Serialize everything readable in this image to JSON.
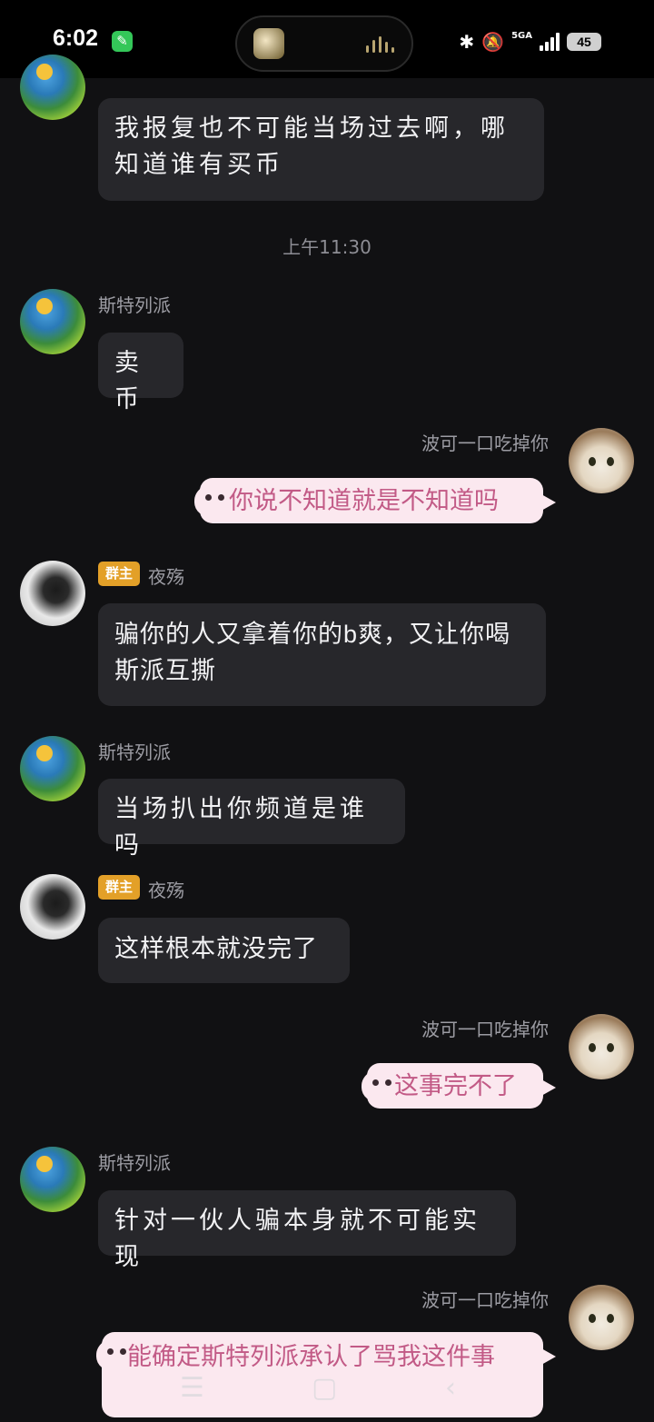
{
  "status_bar": {
    "time": "6:02",
    "network": "5GA",
    "battery": "45",
    "icons": [
      "wrench-app-icon",
      "bluetooth-icon",
      "mute-icon",
      "signal-icon",
      "battery-icon"
    ]
  },
  "timestamp": "上午11:30",
  "messages": [
    {
      "sender": "",
      "text": "我报复也不可能当场过去啊，哪知道谁有买币",
      "side": "left",
      "avatar": "earth-chick"
    },
    {
      "sender": "斯特列派",
      "text": "卖币",
      "side": "left",
      "avatar": "earth-chick"
    },
    {
      "sender": "波可一口吃掉你",
      "text": "你说不知道就是不知道吗",
      "side": "right",
      "avatar": "cat"
    },
    {
      "sender": "夜殇",
      "badge": "群主",
      "text": "骗你的人又拿着你的b爽，又让你喝斯派互撕",
      "side": "left",
      "avatar": "manga"
    },
    {
      "sender": "斯特列派",
      "text": "当场扒出你频道是谁吗",
      "side": "left",
      "avatar": "earth-chick"
    },
    {
      "sender": "夜殇",
      "badge": "群主",
      "text": "这样根本就没完了",
      "side": "left",
      "avatar": "manga"
    },
    {
      "sender": "波可一口吃掉你",
      "text": "这事完不了",
      "side": "right",
      "avatar": "cat"
    },
    {
      "sender": "斯特列派",
      "text": "针对一伙人骗本身就不可能实现",
      "side": "left",
      "avatar": "earth-chick"
    },
    {
      "sender": "波可一口吃掉你",
      "text": "能确定斯特列派承认了骂我这件事",
      "side": "right",
      "avatar": "cat"
    }
  ],
  "colors": {
    "background": "#111113",
    "bubble": "#27272b",
    "pink_bubble": "#fbe8ef",
    "pink_text": "#c25a86",
    "owner_badge": "#e3a028"
  },
  "navbar": {
    "icons": [
      "menu-icon",
      "home-icon",
      "back-icon"
    ]
  }
}
